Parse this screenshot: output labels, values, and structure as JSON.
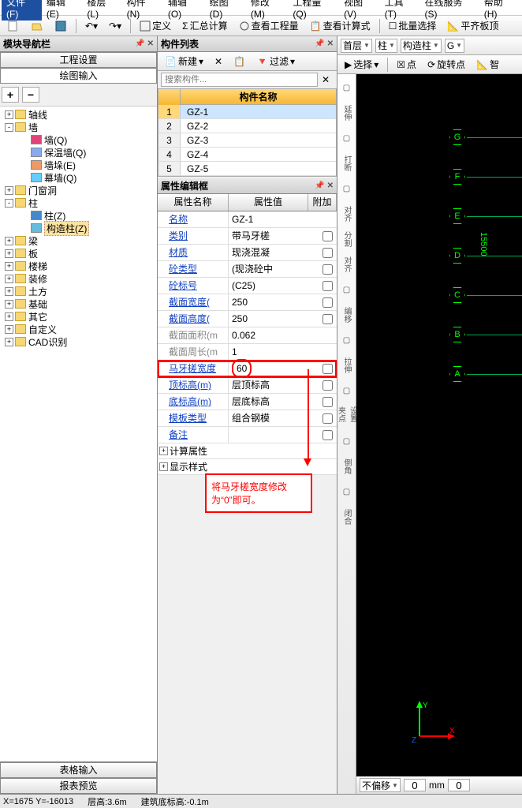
{
  "menu": [
    "文件(F)",
    "编辑(E)",
    "楼层(L)",
    "构件(N)",
    "辅轴(O)",
    "绘图(D)",
    "修改(M)",
    "工程量(Q)",
    "视图(V)",
    "工具(T)",
    "在线服务(S)",
    "帮助(H)"
  ],
  "toolbar2": {
    "define": "定义",
    "sumcalc": "汇总计算",
    "viewqty": "查看工程量",
    "viewformula": "查看计算式",
    "batch": "批量选择",
    "flat": "平齐板顶"
  },
  "left": {
    "title": "模块导航栏",
    "tab1": "工程设置",
    "tab2": "绘图输入",
    "tree": [
      {
        "t": "轴线",
        "lv": 0,
        "tg": "+"
      },
      {
        "t": "墙",
        "lv": 0,
        "tg": "-",
        "open": true
      },
      {
        "t": "墙(Q)",
        "lv": 1,
        "leaf": true,
        "ico": "#d47"
      },
      {
        "t": "保温墙(Q)",
        "lv": 1,
        "leaf": true,
        "ico": "#8ae"
      },
      {
        "t": "墙垛(E)",
        "lv": 1,
        "leaf": true,
        "ico": "#e96"
      },
      {
        "t": "幕墙(Q)",
        "lv": 1,
        "leaf": true,
        "ico": "#6cf"
      },
      {
        "t": "门窗洞",
        "lv": 0,
        "tg": "+"
      },
      {
        "t": "柱",
        "lv": 0,
        "tg": "-",
        "open": true
      },
      {
        "t": "柱(Z)",
        "lv": 1,
        "leaf": true,
        "ico": "#48c"
      },
      {
        "t": "构造柱(Z)",
        "lv": 1,
        "leaf": true,
        "ico": "#6bd",
        "sel": true
      },
      {
        "t": "梁",
        "lv": 0,
        "tg": "+"
      },
      {
        "t": "板",
        "lv": 0,
        "tg": "+"
      },
      {
        "t": "楼梯",
        "lv": 0,
        "tg": "+"
      },
      {
        "t": "装修",
        "lv": 0,
        "tg": "+"
      },
      {
        "t": "土方",
        "lv": 0,
        "tg": "+"
      },
      {
        "t": "基础",
        "lv": 0,
        "tg": "+"
      },
      {
        "t": "其它",
        "lv": 0,
        "tg": "+"
      },
      {
        "t": "自定义",
        "lv": 0,
        "tg": "+"
      },
      {
        "t": "CAD识别",
        "lv": 0,
        "tg": "+"
      }
    ],
    "bot1": "表格输入",
    "bot2": "报表预览"
  },
  "mid": {
    "title": "构件列表",
    "new": "新建",
    "filter": "过滤",
    "search_ph": "搜索构件...",
    "grid_hdr": "构件名称",
    "rows": [
      "GZ-1",
      "GZ-2",
      "GZ-3",
      "GZ-4",
      "GZ-5"
    ],
    "prop_title": "属性编辑框",
    "col1": "属性名称",
    "col2": "属性值",
    "col3": "附加",
    "props": [
      {
        "n": "名称",
        "v": "GZ-1",
        "link": true
      },
      {
        "n": "类别",
        "v": "带马牙槎",
        "link": true,
        "cb": true
      },
      {
        "n": "材质",
        "v": "现浇混凝",
        "link": true,
        "cb": true
      },
      {
        "n": "砼类型",
        "v": "(现浇砼中",
        "link": true,
        "cb": true
      },
      {
        "n": "砼标号",
        "v": "(C25)",
        "link": true,
        "cb": true
      },
      {
        "n": "截面宽度(",
        "v": "250",
        "link": true,
        "cb": true
      },
      {
        "n": "截面高度(",
        "v": "250",
        "link": true,
        "cb": true
      },
      {
        "n": "截面面积(m",
        "v": "0.062",
        "link": false
      },
      {
        "n": "截面周长(m",
        "v": "1",
        "link": false
      },
      {
        "n": "马牙槎宽度",
        "v": "60",
        "link": true,
        "cb": true,
        "hl": true
      },
      {
        "n": "顶标高(m)",
        "v": "层顶标高",
        "link": true,
        "cb": true
      },
      {
        "n": "底标高(m)",
        "v": "层底标高",
        "link": true,
        "cb": true
      },
      {
        "n": "模板类型",
        "v": "组合钢模",
        "link": true,
        "cb": true
      },
      {
        "n": "备注",
        "v": "",
        "link": true,
        "cb": true
      }
    ],
    "group1": "计算属性",
    "group2": "显示样式",
    "annotation": "将马牙槎宽度修改为“0”即可。"
  },
  "right": {
    "floor": "首层",
    "kind": "柱",
    "sub": "构造柱",
    "select": "选择",
    "point": "点",
    "rotpoint": "旋转点",
    "smart": "智",
    "labels": [
      "G",
      "F",
      "E",
      "D",
      "C",
      "B",
      "A"
    ],
    "dim": "15500",
    "offset": "不偏移",
    "mm": "mm"
  },
  "vtool": [
    "",
    "延伸",
    "",
    "打断",
    "",
    "对齐",
    "分割",
    "对齐",
    "",
    "编移",
    "",
    "拉伸",
    "",
    "设置夹点",
    "",
    "倒角",
    "",
    "闭合"
  ],
  "status": {
    "coord": "X=1675 Y=-16013",
    "h": "层高:3.6m",
    "base": "建筑底标高:-0.1m"
  }
}
